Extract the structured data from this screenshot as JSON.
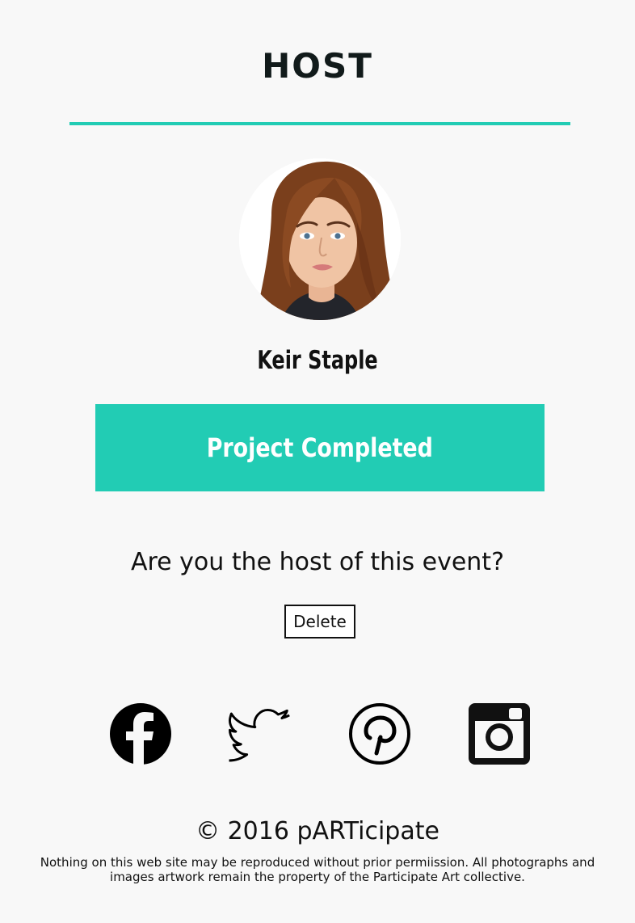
{
  "section": {
    "title": "HOST"
  },
  "host": {
    "name": "Keir Staple",
    "status_label": "Project Completed"
  },
  "ownership": {
    "question": "Are you the host of this event?",
    "delete_label": "Delete"
  },
  "social": {
    "icons": [
      "facebook-icon",
      "twitter-icon",
      "pinterest-icon",
      "instagram-icon"
    ]
  },
  "footer": {
    "copyright": "© 2016 pARTicipate",
    "disclaimer": "Nothing on this web site may be reproduced without prior permiission. All photographs and images artwork remain the property of the Participate Art collective."
  },
  "colors": {
    "accent": "#22ccb4",
    "background": "#f8f8f8",
    "text": "#111111"
  }
}
